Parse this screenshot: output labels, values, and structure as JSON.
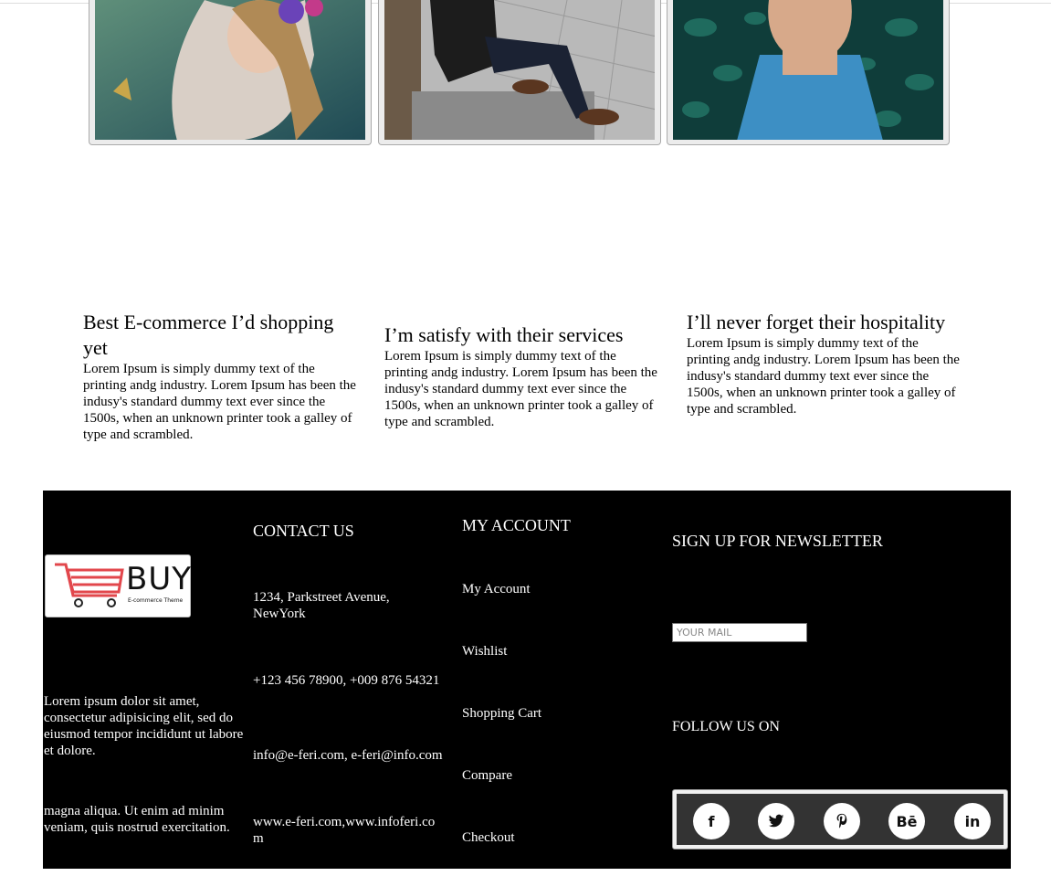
{
  "testimonials": [
    {
      "title": "Best E-commerce I’d shopping yet",
      "body": "Lorem Ipsum is simply dummy text of the printing andg industry. Lorem Ipsum has been the indusy's standard dummy text ever since the 1500s, when an unknown printer took a galley of type and scrambled."
    },
    {
      "title": "I’m satisfy with their services",
      "body": "Lorem Ipsum is simply dummy text of the printing andg industry. Lorem Ipsum has been the indusy's standard dummy text ever since the 1500s, when an unknown printer took a galley of type and scrambled."
    },
    {
      "title": "I’ll never forget their hospitality",
      "body": "Lorem Ipsum is simply dummy text of the printing andg industry. Lorem Ipsum has been the indusy's standard dummy text ever since the 1500s, when an unknown printer took a galley of type and scrambled."
    }
  ],
  "footer": {
    "logo": {
      "word": "BUY",
      "tagline": "E-commerce Theme"
    },
    "about": [
      "Lorem ipsum dolor sit amet, consectetur adipisicing elit, sed do eiusmod tempor incididunt ut labore et dolore.",
      "magna aliqua. Ut enim ad minim veniam, quis nostrud exercitation."
    ],
    "contact": {
      "heading": "CONTACT US",
      "address": "1234, Parkstreet Avenue, NewYork",
      "phone": "+123 456 78900, +009 876 54321",
      "email": "info@e-feri.com, e-feri@info.com",
      "web": "www.e-feri.com,www.infoferi.com"
    },
    "account": {
      "heading": "MY ACCOUNT",
      "links": [
        "My Account",
        "Wishlist",
        "Shopping Cart",
        "Compare",
        "Checkout"
      ]
    },
    "newsletter": {
      "heading": "SIGN UP FOR NEWSLETTER",
      "placeholder": "YOUR MAIL"
    },
    "follow": {
      "heading": "FOLLOW US ON",
      "icons": [
        {
          "name": "facebook-icon",
          "glyph": "f"
        },
        {
          "name": "twitter-icon",
          "glyph": "🐦"
        },
        {
          "name": "pinterest-icon",
          "glyph": "P"
        },
        {
          "name": "behance-icon",
          "glyph": "Bē"
        },
        {
          "name": "linkedin-icon",
          "glyph": "in"
        }
      ]
    }
  },
  "colors": {
    "footer_bg": "#000000",
    "logo_cart": "#e2474c",
    "social_bar": "#333333"
  }
}
